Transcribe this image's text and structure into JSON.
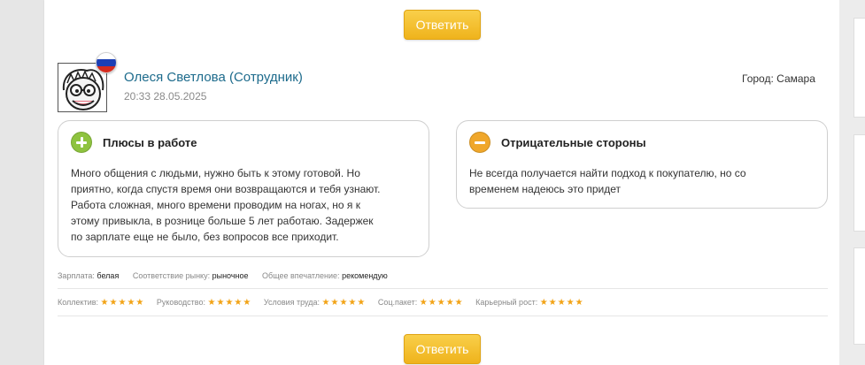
{
  "reply_button_label": "Ответить",
  "review": {
    "author": "Олеся Светлова (Сотрудник)",
    "datetime": "20:33 28.05.2025",
    "city_label": "Город:",
    "city": "Самара",
    "flag_icon": "russia-flag-icon",
    "avatar_icon": "cartoon-face-avatar"
  },
  "pros": {
    "title": "Плюсы в работе",
    "icon": "plus-icon",
    "icon_color": "#8ec33f",
    "lines": [
      "Много общения с людьми, нужно быть к этому готовой. Но",
      "приятно, когда спустя время они возвращаются и тебя узнают.",
      "Работа сложная, много времени проводим на ногах, но я к",
      "этому привыкла, в рознице больше 5 лет работаю. Задержек",
      "по зарплате еще не было, без вопросов все приходит."
    ]
  },
  "cons": {
    "title": "Отрицательные стороны",
    "icon": "minus-icon",
    "icon_color": "#f0a72a",
    "lines": [
      "Не всегда получается найти подход к покупателю, но со",
      "временем надеюсь это придет"
    ]
  },
  "meta": [
    {
      "label": "Зарплата:",
      "value": "белая"
    },
    {
      "label": "Соответствие рынку:",
      "value": "рыночное"
    },
    {
      "label": "Общее впечатление:",
      "value": "рекомендую"
    }
  ],
  "ratings": [
    {
      "label": "Коллектив:",
      "stars": 5
    },
    {
      "label": "Руководство:",
      "stars": 5
    },
    {
      "label": "Условия труда:",
      "stars": 5
    },
    {
      "label": "Соц.пакет:",
      "stars": 5
    },
    {
      "label": "Карьерный рост:",
      "stars": 5
    }
  ],
  "colors": {
    "accent_button": "#f3bd2b",
    "author_link": "#1d6b8c",
    "star": "#f2a316"
  }
}
